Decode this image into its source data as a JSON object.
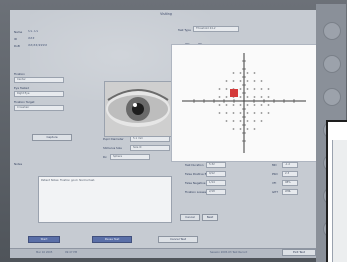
{
  "window": {
    "title": "Visiting"
  },
  "patient": {
    "name_label": "Name",
    "name_value": "S.S. A.S",
    "id_label": "ID",
    "id_value": "###",
    "dob_label": "DoB",
    "dob_value": "##/##/####"
  },
  "left": {
    "fixation_label": "Fixation",
    "fixation_value": "Center",
    "eye_tested_label": "Eye Tested",
    "eye_tested_value": "Right Eye",
    "fixation_target_label": "Fixation Target",
    "fixation_target_value": "Crosshair",
    "capture_button": "Capture",
    "pupil_diameter_label": "Pupil Diameter",
    "pupil_diameter_value": "5.1 mm",
    "stimulus_size_label": "Stimulus Size",
    "stimulus_size_value": "Size III",
    "rx_label": "Rx",
    "rx_value": "Sphere",
    "notes_label": "Notes",
    "notes_value": "Patient Notes: Fixation good. Normal test."
  },
  "test": {
    "type_label": "Test Type",
    "type_value": "Threshold 24-2"
  },
  "grid_tabs": [
    "OD",
    "OS"
  ],
  "stats": [
    {
      "label": "Test Duration",
      "value": "5:32"
    },
    {
      "label": "False Positive Errors",
      "value": "0/12"
    },
    {
      "label": "False Negative Errors",
      "value": "1/14"
    },
    {
      "label": "Fixation Losses",
      "value": "2/18"
    },
    {
      "label": "MD",
      "value": "-1.2"
    },
    {
      "label": "PSD",
      "value": "2.3"
    },
    {
      "label": "VFI",
      "value": "98%"
    },
    {
      "label": "GHT",
      "value": "WNL"
    }
  ],
  "bottom_buttons": {
    "start": "Start",
    "pause": "Pause Test",
    "cancel": "Cancel Test",
    "small_a": "Cancel",
    "small_b": "Next"
  },
  "status": {
    "date": "Mar 16 2005",
    "time": "09:47 PM",
    "session": "Session 2005-03 Test Record",
    "right_button": "Exit Test"
  },
  "side_icons": [
    "eye-icon",
    "wrench-icon",
    "grid-icon",
    "target-icon",
    "user-icon",
    "print-icon",
    "chart-icon"
  ],
  "colors": {
    "accent": "#5a6fa8",
    "stimulus": "#d43a3a",
    "panel_border": "#1e1e1e"
  }
}
